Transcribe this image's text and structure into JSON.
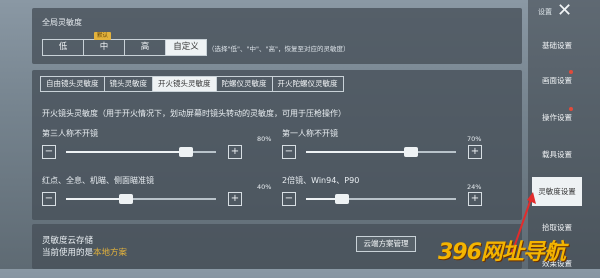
{
  "sensitivity": {
    "global_label": "全局灵敏度",
    "default_badge": "默认",
    "options": [
      "低",
      "中",
      "高",
      "自定义"
    ],
    "active_option": 3,
    "hint": "（选择\"低\"、\"中\"、\"高\"，恢复至对应的灵敏度）"
  },
  "tabs": [
    "自由镜头灵敏度",
    "镜头灵敏度",
    "开火镜头灵敏度",
    "陀螺仪灵敏度",
    "开火陀螺仪灵敏度"
  ],
  "active_tab": 2,
  "fire_section": {
    "title": "开火镜头灵敏度（用于开火情况下，划动屏幕时镜头转动的灵敏度，可用于压枪操作）",
    "sliders": [
      {
        "label": "第三人称不开镜",
        "value": "80%",
        "fraction": 0.8
      },
      {
        "label": "第一人称不开镜",
        "value": "70%",
        "fraction": 0.7
      },
      {
        "label": "红点、全息、机瞄、侧面瞄准镜",
        "value": "40%",
        "fraction": 0.4
      },
      {
        "label": "2倍镜、Win94、P90",
        "value": "24%",
        "fraction": 0.24
      }
    ]
  },
  "cloud": {
    "title": "灵敏度云存储",
    "current_prefix": "当前使用的是",
    "current_plan": "本地方案",
    "manage_button": "云端方案管理"
  },
  "sidebar": {
    "top_label": "设置",
    "items": [
      "基础设置",
      "画面设置",
      "操作设置",
      "载具设置",
      "灵敏度设置",
      "拾取设置",
      "效果设置"
    ],
    "active_item": 4
  },
  "watermark": "396网址导航",
  "colors": {
    "accent_red": "#e14b3b",
    "badge_gold": "#e3b23c",
    "panel": "#46505a"
  }
}
